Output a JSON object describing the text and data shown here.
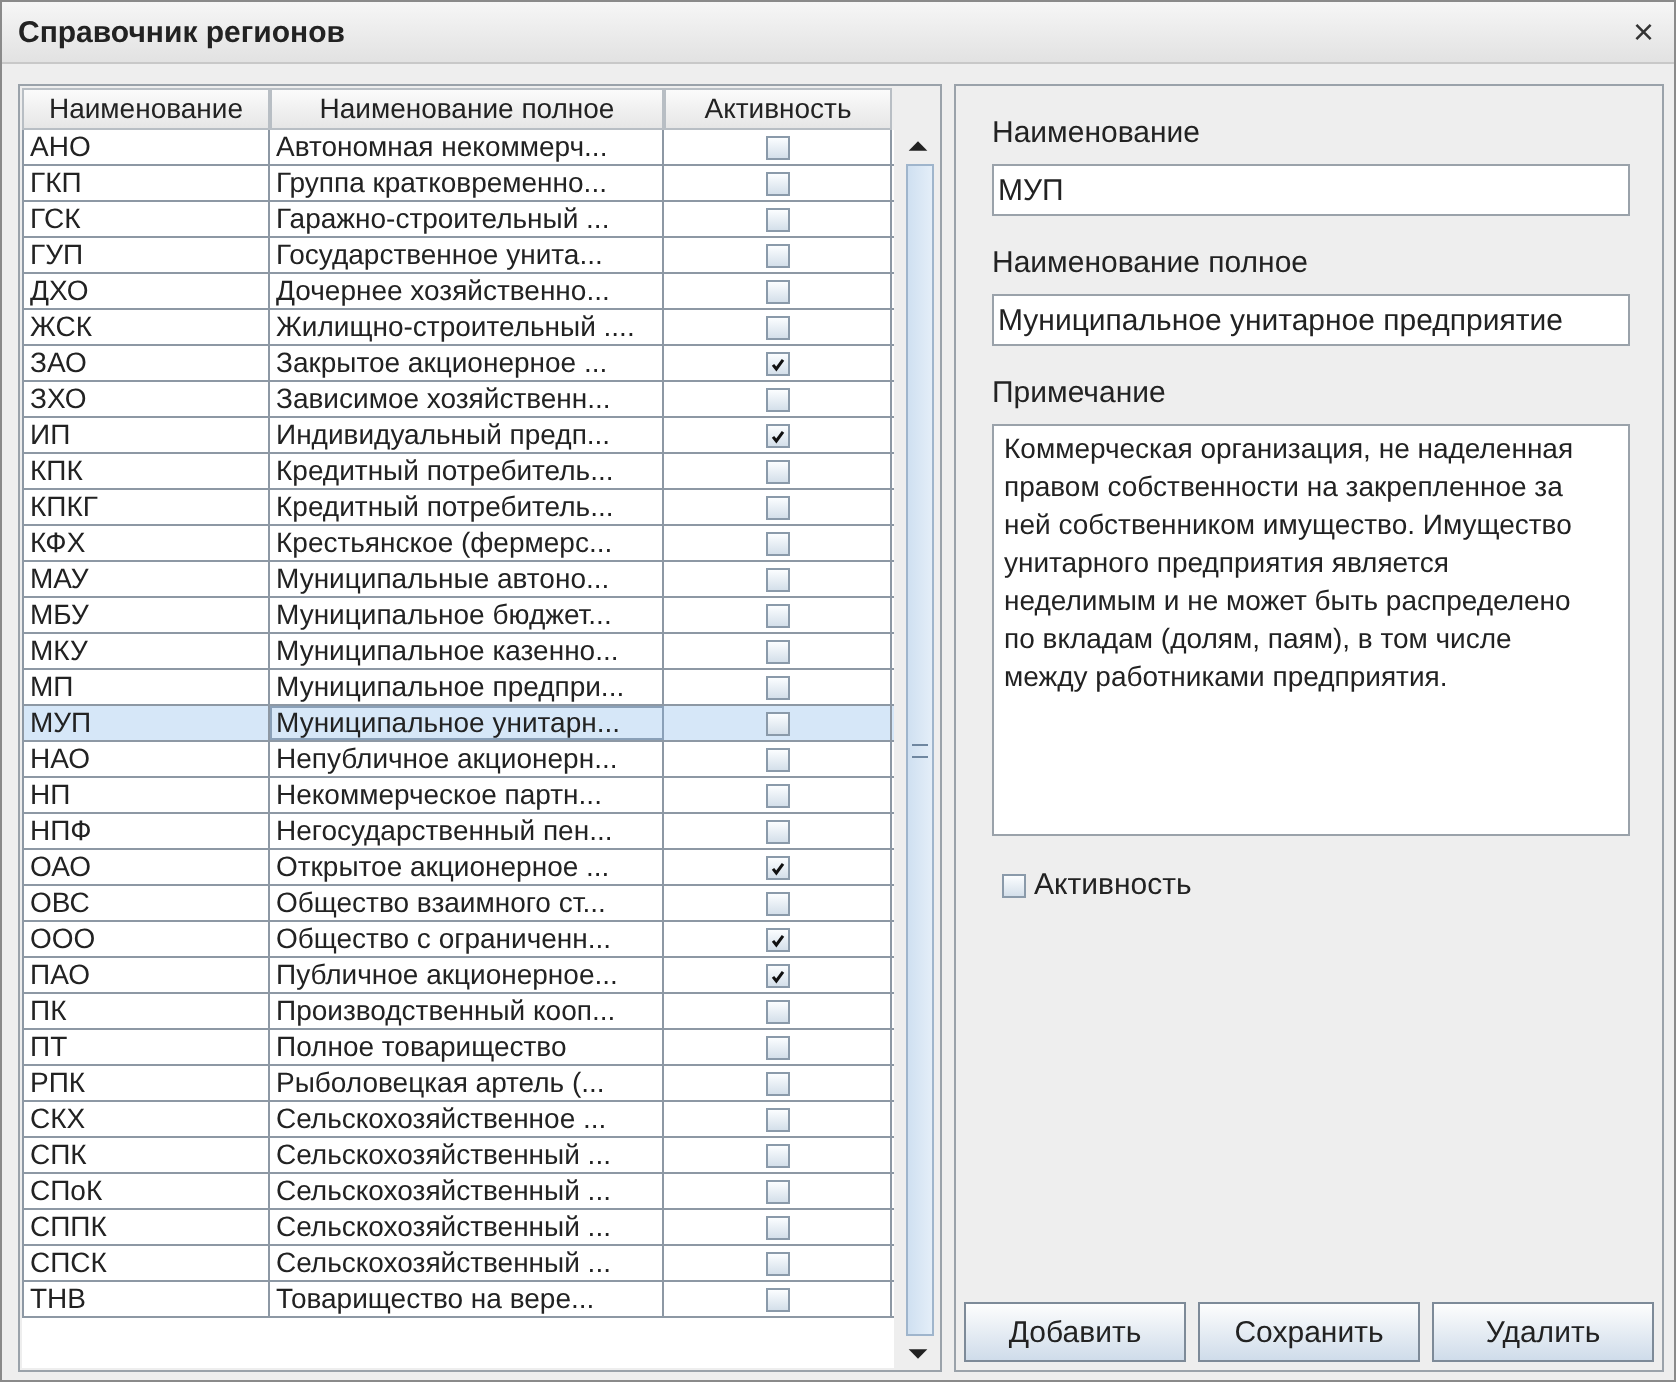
{
  "window": {
    "title": "Справочник регионов",
    "close": "×"
  },
  "table": {
    "columns": [
      "Наименование",
      "Наименование полное",
      "Активность"
    ],
    "rows": [
      {
        "name": "АНО",
        "full": "Автономная некоммерч...",
        "active": false,
        "selected": false
      },
      {
        "name": "ГКП",
        "full": "Группа кратковременно...",
        "active": false,
        "selected": false
      },
      {
        "name": "ГСК",
        "full": "Гаражно-строительный ...",
        "active": false,
        "selected": false
      },
      {
        "name": "ГУП",
        "full": "Государственное унита...",
        "active": false,
        "selected": false
      },
      {
        "name": "ДХО",
        "full": "Дочернее хозяйственно...",
        "active": false,
        "selected": false
      },
      {
        "name": "ЖСК",
        "full": "Жилищно-строительный ....",
        "active": false,
        "selected": false
      },
      {
        "name": "ЗАО",
        "full": "Закрытое акционерное ...",
        "active": true,
        "selected": false
      },
      {
        "name": "ЗХО",
        "full": "Зависимое хозяйственн...",
        "active": false,
        "selected": false
      },
      {
        "name": "ИП",
        "full": "Индивидуальный предп...",
        "active": true,
        "selected": false
      },
      {
        "name": "КПК",
        "full": "Кредитный потребитель...",
        "active": false,
        "selected": false
      },
      {
        "name": "КПКГ",
        "full": "Кредитный потребитель...",
        "active": false,
        "selected": false
      },
      {
        "name": "КФХ",
        "full": "Крестьянское (фермерс...",
        "active": false,
        "selected": false
      },
      {
        "name": "МАУ",
        "full": "Муниципальные автоно...",
        "active": false,
        "selected": false
      },
      {
        "name": "МБУ",
        "full": "Муниципальное бюджет...",
        "active": false,
        "selected": false
      },
      {
        "name": "МКУ",
        "full": "Муниципальное казенно...",
        "active": false,
        "selected": false
      },
      {
        "name": "МП",
        "full": "Муниципальное предпри...",
        "active": false,
        "selected": false
      },
      {
        "name": "МУП",
        "full": "Муниципальное унитарн...",
        "active": false,
        "selected": true
      },
      {
        "name": "НАО",
        "full": "Непубличное акционерн...",
        "active": false,
        "selected": false
      },
      {
        "name": "НП",
        "full": "Некоммерческое партн...",
        "active": false,
        "selected": false
      },
      {
        "name": "НПФ",
        "full": "Негосударственный пен...",
        "active": false,
        "selected": false
      },
      {
        "name": "ОАО",
        "full": "Открытое акционерное ...",
        "active": true,
        "selected": false
      },
      {
        "name": "ОВС",
        "full": "Общество взаимного ст...",
        "active": false,
        "selected": false
      },
      {
        "name": "ООО",
        "full": "Общество с ограниченн...",
        "active": true,
        "selected": false
      },
      {
        "name": "ПАО",
        "full": "Публичное акционерное...",
        "active": true,
        "selected": false
      },
      {
        "name": "ПК",
        "full": "Производственный кооп...",
        "active": false,
        "selected": false
      },
      {
        "name": "ПТ",
        "full": "Полное товарищество",
        "active": false,
        "selected": false
      },
      {
        "name": "РПК",
        "full": "Рыболовецкая артель (...",
        "active": false,
        "selected": false
      },
      {
        "name": "СКХ",
        "full": "Сельскохозяйственное ...",
        "active": false,
        "selected": false
      },
      {
        "name": "СПК",
        "full": "Сельскохозяйственный ...",
        "active": false,
        "selected": false
      },
      {
        "name": "СПоК",
        "full": "Сельскохозяйственный ...",
        "active": false,
        "selected": false
      },
      {
        "name": "СППК",
        "full": "Сельскохозяйственный ...",
        "active": false,
        "selected": false
      },
      {
        "name": "СПСК",
        "full": "Сельскохозяйственный ...",
        "active": false,
        "selected": false
      },
      {
        "name": "ТНВ",
        "full": "Товарищество на вере...",
        "active": false,
        "selected": false
      }
    ]
  },
  "form": {
    "name_label": "Наименование",
    "name_value": "МУП",
    "full_label": "Наименование полное",
    "full_value": "Муниципальное унитарное предприятие",
    "note_label": "Примечание",
    "note_value": "Коммерческая организация, не наделенная правом собственности на закрепленное за ней собственником имущество. Имущество унитарного предприятия является неделимым и не может быть распределено по вкладам (долям, паям), в том числе между работниками предприятия.",
    "active_label": "Активность",
    "active": false
  },
  "buttons": [
    "Добавить",
    "Сохранить",
    "Удалить"
  ]
}
